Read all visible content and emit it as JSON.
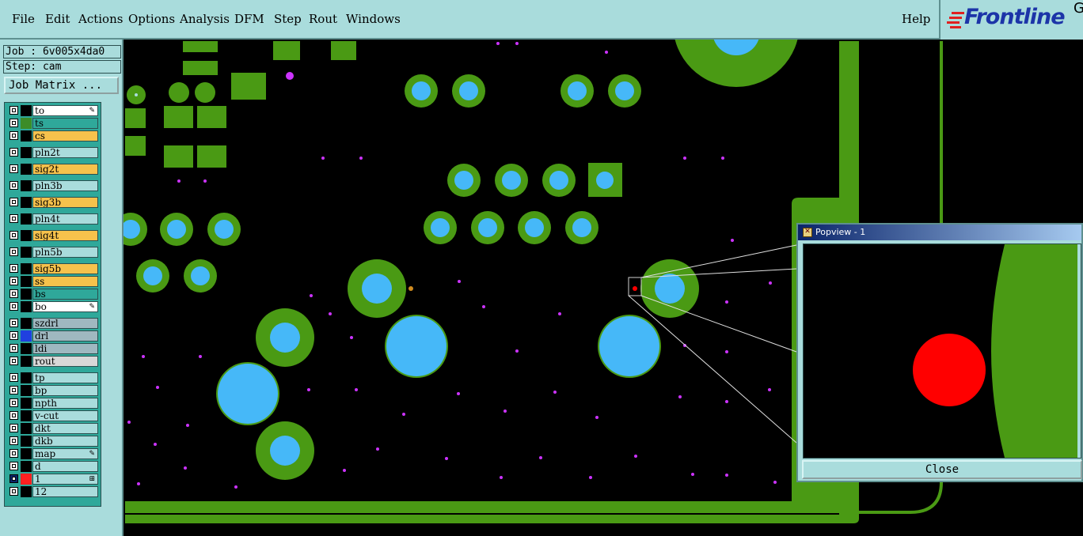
{
  "menu": {
    "items": [
      "File",
      "Edit",
      "Actions",
      "Options",
      "Analysis",
      "DFM",
      "Step",
      "Rout",
      "Windows"
    ],
    "help": "Help"
  },
  "logo": {
    "text": "Frontline",
    "suffix": "G"
  },
  "job": {
    "job_line": "Job : 6v005x4da0",
    "step_line": "Step: cam",
    "matrix_button": "Job Matrix ..."
  },
  "layers": [
    {
      "name": "to",
      "color": "#ffffff",
      "swatch": "#000000",
      "mark": "pencil"
    },
    {
      "name": "ts",
      "color": "#2fa89a",
      "swatch": "#3c8c28"
    },
    {
      "name": "cs",
      "color": "#f6c24c",
      "swatch": "#000000"
    },
    {
      "name": "pln2t",
      "color": "#a9dcdc",
      "swatch": "#000000"
    },
    {
      "name": "sig2t",
      "color": "#f6c24c",
      "swatch": "#000000"
    },
    {
      "name": "pln3b",
      "color": "#a9dcdc",
      "swatch": "#000000"
    },
    {
      "name": "sig3b",
      "color": "#f6c24c",
      "swatch": "#000000"
    },
    {
      "name": "pln4t",
      "color": "#a9dcdc",
      "swatch": "#000000"
    },
    {
      "name": "sig4t",
      "color": "#f6c24c",
      "swatch": "#000000"
    },
    {
      "name": "pln5b",
      "color": "#a9dcdc",
      "swatch": "#000000"
    },
    {
      "name": "sig5b",
      "color": "#f6c24c",
      "swatch": "#000000"
    },
    {
      "name": "ss",
      "color": "#f6c24c",
      "swatch": "#000000"
    },
    {
      "name": "bs",
      "color": "#2fa89a",
      "swatch": "#000000"
    },
    {
      "name": "bo",
      "color": "#ffffff",
      "swatch": "#000000",
      "mark": "pencil"
    },
    {
      "name": "szdrl",
      "color": "#9fb8c0",
      "swatch": "#000000"
    },
    {
      "name": "drl",
      "color": "#9fb8c0",
      "swatch": "#2040e0"
    },
    {
      "name": "ldi",
      "color": "#9fb8c0",
      "swatch": "#000000"
    },
    {
      "name": "rout",
      "color": "#d8d8d8",
      "swatch": "#000000"
    },
    {
      "name": "tp",
      "color": "#a9dcdc",
      "swatch": "#000000"
    },
    {
      "name": "bp",
      "color": "#a9dcdc",
      "swatch": "#000000"
    },
    {
      "name": "npth",
      "color": "#a9dcdc",
      "swatch": "#000000"
    },
    {
      "name": "v-cut",
      "color": "#a9dcdc",
      "swatch": "#000000"
    },
    {
      "name": "dkt",
      "color": "#a9dcdc",
      "swatch": "#000000"
    },
    {
      "name": "dkb",
      "color": "#a9dcdc",
      "swatch": "#000000"
    },
    {
      "name": "map",
      "color": "#a9dcdc",
      "swatch": "#000000",
      "mark": "pencil"
    },
    {
      "name": "d",
      "color": "#a9dcdc",
      "swatch": "#000000"
    },
    {
      "name": "1",
      "color": "#a9dcdc",
      "swatch": "#ff2020",
      "checked": true,
      "mark": "grid"
    },
    {
      "name": "12",
      "color": "#a9dcdc",
      "swatch": "#000000"
    }
  ],
  "colors": {
    "copper": "#4a9a14",
    "drill": "#46b8f8",
    "via": "#cc33ff",
    "highlight": "#ff0000",
    "panel": "#a9dcdc"
  },
  "popview": {
    "title": "Popview - 1",
    "close_label": "Close"
  }
}
